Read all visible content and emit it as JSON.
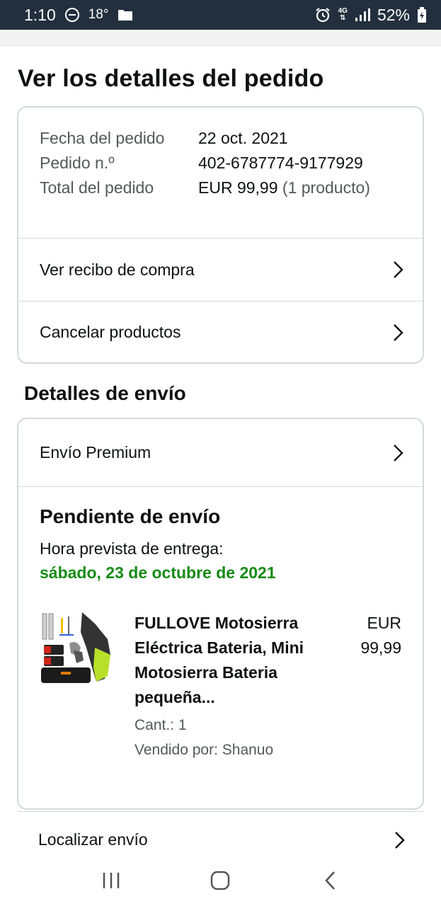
{
  "status_bar": {
    "time": "1:10",
    "temperature": "18°",
    "network": "4G",
    "battery": "52%"
  },
  "page": {
    "title": "Ver los detalles del pedido"
  },
  "order_summary": {
    "rows": [
      {
        "label": "Fecha del pedido",
        "value": "22 oct. 2021"
      },
      {
        "label": "Pedido n.º",
        "value": "402-6787774-9177929"
      },
      {
        "label": "Total del pedido",
        "value": "EUR 99,99",
        "extra": "(1 producto)"
      }
    ],
    "links": [
      {
        "label": "Ver recibo de compra"
      },
      {
        "label": "Cancelar productos"
      }
    ]
  },
  "shipping": {
    "section_title": "Detalles de envío",
    "method_label": "Envío Premium",
    "status": "Pendiente de envío",
    "eta_label": "Hora prevista de entrega:",
    "eta_date": "sábado, 23 de octubre de 2021",
    "product": {
      "name": "FULLOVE Motosierra Eléctrica Bateria, Mini Motosierra Bateria pequeña...",
      "quantity": "Cant.: 1",
      "seller": "Vendido por: Shanuo",
      "price_currency": "EUR",
      "price_value": "99,99"
    },
    "track_label": "Localizar envío"
  },
  "colors": {
    "status_bar": "#232f3e",
    "eta_green": "#168a16",
    "border": "#d5d9d9",
    "label_grey": "#565959"
  },
  "icons": {
    "chevron": "chevron-right-icon",
    "recents": "recents-icon",
    "home": "home-icon",
    "back": "back-icon"
  }
}
